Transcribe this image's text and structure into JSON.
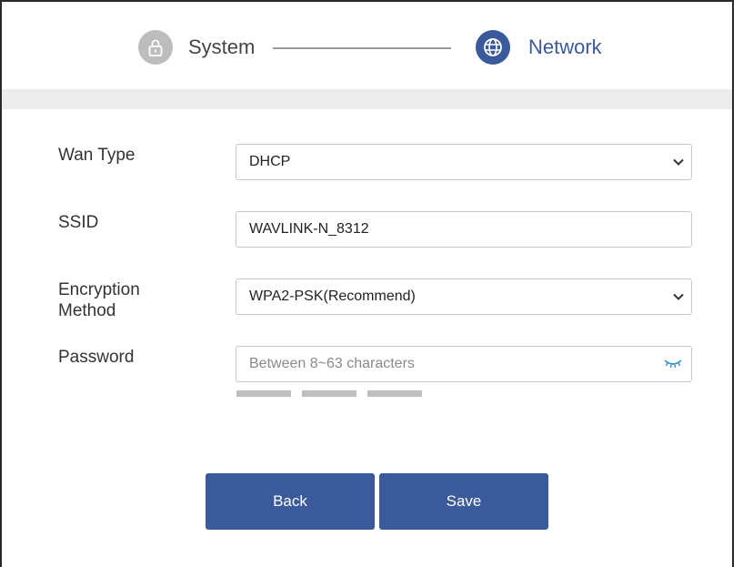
{
  "stepper": {
    "steps": [
      {
        "label": "System",
        "state": "done",
        "icon": "lock-icon"
      },
      {
        "label": "Network",
        "state": "active",
        "icon": "globe-icon"
      }
    ]
  },
  "form": {
    "wan_type": {
      "label": "Wan Type",
      "value": "DHCP"
    },
    "ssid": {
      "label": "SSID",
      "value": "WAVLINK-N_8312"
    },
    "encryption": {
      "label_line1": "Encryption",
      "label_line2": "Method",
      "value": "WPA2-PSK(Recommend)"
    },
    "password": {
      "label": "Password",
      "value": "",
      "placeholder": "Between 8~63 characters",
      "toggle_icon": "eye-closed-icon"
    },
    "strength_bars": 3
  },
  "buttons": {
    "back_label": "Back",
    "save_label": "Save"
  },
  "colors": {
    "accent": "#3b5a9b",
    "inactive_step": "#bdbdbd",
    "strength_bar": "#bfbfbf"
  }
}
